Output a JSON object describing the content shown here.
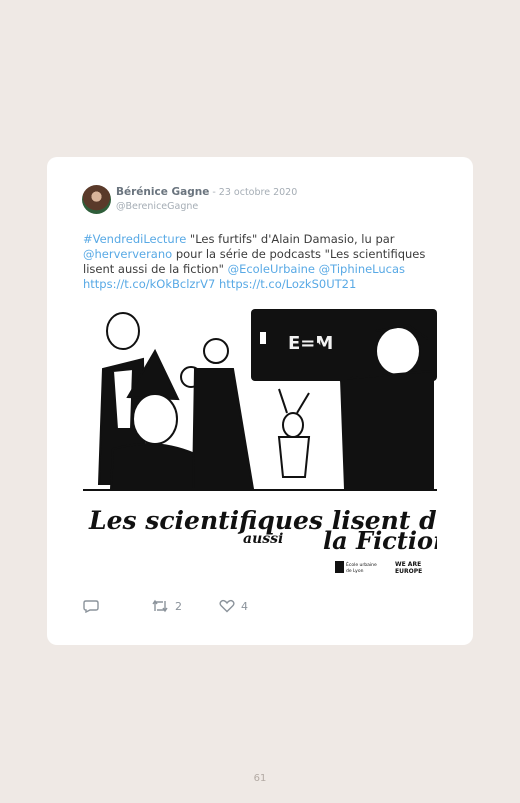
{
  "tweet": {
    "author_name": "Bérénice Gagne",
    "date": " - 23 octobre 2020",
    "handle": "@BereniceGagne",
    "text": {
      "hashtag": "#VendrediLecture",
      "part1": " \"Les furtifs\" d'Alain Damasio, lu par ",
      "mention1": "@herververano",
      "part2": " pour la série de podcasts \"Les scientifiques lisent aussi de la fiction\" ",
      "mention2": "@EcoleUrbaine",
      "mention3": "@TiphineLucas",
      "link1": "https://t.co/kOkBclzrV7",
      "link2": "https://t.co/LozkS0UT21"
    },
    "image": {
      "caption_line1": "Les scientifiques lisent de",
      "caption_aussi": "aussi",
      "caption_line2": "la Fiction",
      "blackboard_text": "E=M",
      "logo1_line1": "École urbaine",
      "logo1_line2": "de Lyon",
      "logo2_line1": "WE ARE",
      "logo2_line2": "EUROPE"
    },
    "actions": {
      "retweets": "2",
      "likes": "4"
    }
  },
  "page": {
    "number": "61"
  }
}
